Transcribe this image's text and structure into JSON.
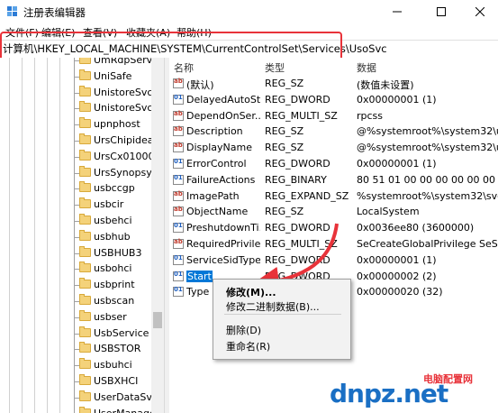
{
  "window": {
    "title": "注册表编辑器",
    "icon": "registry-editor-icon"
  },
  "menu": [
    "文件(F)",
    "编辑(E)",
    "查看(V)",
    "收藏夹(A)",
    "帮助(H)"
  ],
  "address": "计算机\\HKEY_LOCAL_MACHINE\\SYSTEM\\CurrentControlSet\\Services\\UsoSvc",
  "tree": {
    "items": [
      "UmRdpService",
      "UniSafe",
      "UnistoreSvc",
      "UnistoreSvc_4",
      "upnphost",
      "UrsChipidea",
      "UrsCx01000",
      "UrsSynopsys",
      "usbccgp",
      "usbcir",
      "usbehci",
      "usbhub",
      "USBHUB3",
      "usbohci",
      "usbprint",
      "usbscan",
      "usbser",
      "UsbService",
      "USBSTOR",
      "usbuhci",
      "USBXHCI",
      "UserDataSvc",
      "UserManager"
    ]
  },
  "values": {
    "headers": {
      "name": "名称",
      "type": "类型",
      "data": "数据"
    },
    "rows": [
      {
        "name": "(默认)",
        "type": "REG_SZ",
        "data": "(数值未设置)",
        "icon": "sz"
      },
      {
        "name": "DelayedAutoSt...",
        "type": "REG_DWORD",
        "data": "0x00000001 (1)",
        "icon": "bin"
      },
      {
        "name": "DependOnSer...",
        "type": "REG_MULTI_SZ",
        "data": "rpcss",
        "icon": "sz"
      },
      {
        "name": "Description",
        "type": "REG_SZ",
        "data": "@%systemroot%\\system32\\uso",
        "icon": "sz"
      },
      {
        "name": "DisplayName",
        "type": "REG_SZ",
        "data": "@%systemroot%\\system32\\uso",
        "icon": "sz"
      },
      {
        "name": "ErrorControl",
        "type": "REG_DWORD",
        "data": "0x00000001 (1)",
        "icon": "bin"
      },
      {
        "name": "FailureActions",
        "type": "REG_BINARY",
        "data": "80 51 01 00 00 00 00 00 00 00",
        "icon": "bin"
      },
      {
        "name": "ImagePath",
        "type": "REG_EXPAND_SZ",
        "data": "%systemroot%\\system32\\svcho",
        "icon": "sz"
      },
      {
        "name": "ObjectName",
        "type": "REG_SZ",
        "data": "LocalSystem",
        "icon": "sz"
      },
      {
        "name": "PreshutdownTi...",
        "type": "REG_DWORD",
        "data": "0x0036ee80 (3600000)",
        "icon": "bin"
      },
      {
        "name": "RequiredPrivile...",
        "type": "REG_MULTI_SZ",
        "data": "SeCreateGlobalPrivilege SeShut",
        "icon": "sz"
      },
      {
        "name": "ServiceSidType",
        "type": "REG_DWORD",
        "data": "0x00000001 (1)",
        "icon": "bin"
      },
      {
        "name": "Start",
        "type": "REG_DWORD",
        "data": "0x00000002 (2)",
        "icon": "bin",
        "selected": true
      },
      {
        "name": "Type",
        "type": "REG_DWORD",
        "data": "0x00000020 (32)",
        "icon": "bin"
      }
    ]
  },
  "context_menu": {
    "items": [
      "修改(M)...",
      "修改二进制数据(B)...",
      "删除(D)",
      "重命名(R)"
    ]
  },
  "watermark": {
    "text": "电脑配置网",
    "logo": "dnpz.net"
  },
  "colors": {
    "highlight_red": "#e8333a",
    "selection_blue": "#0078d7"
  }
}
